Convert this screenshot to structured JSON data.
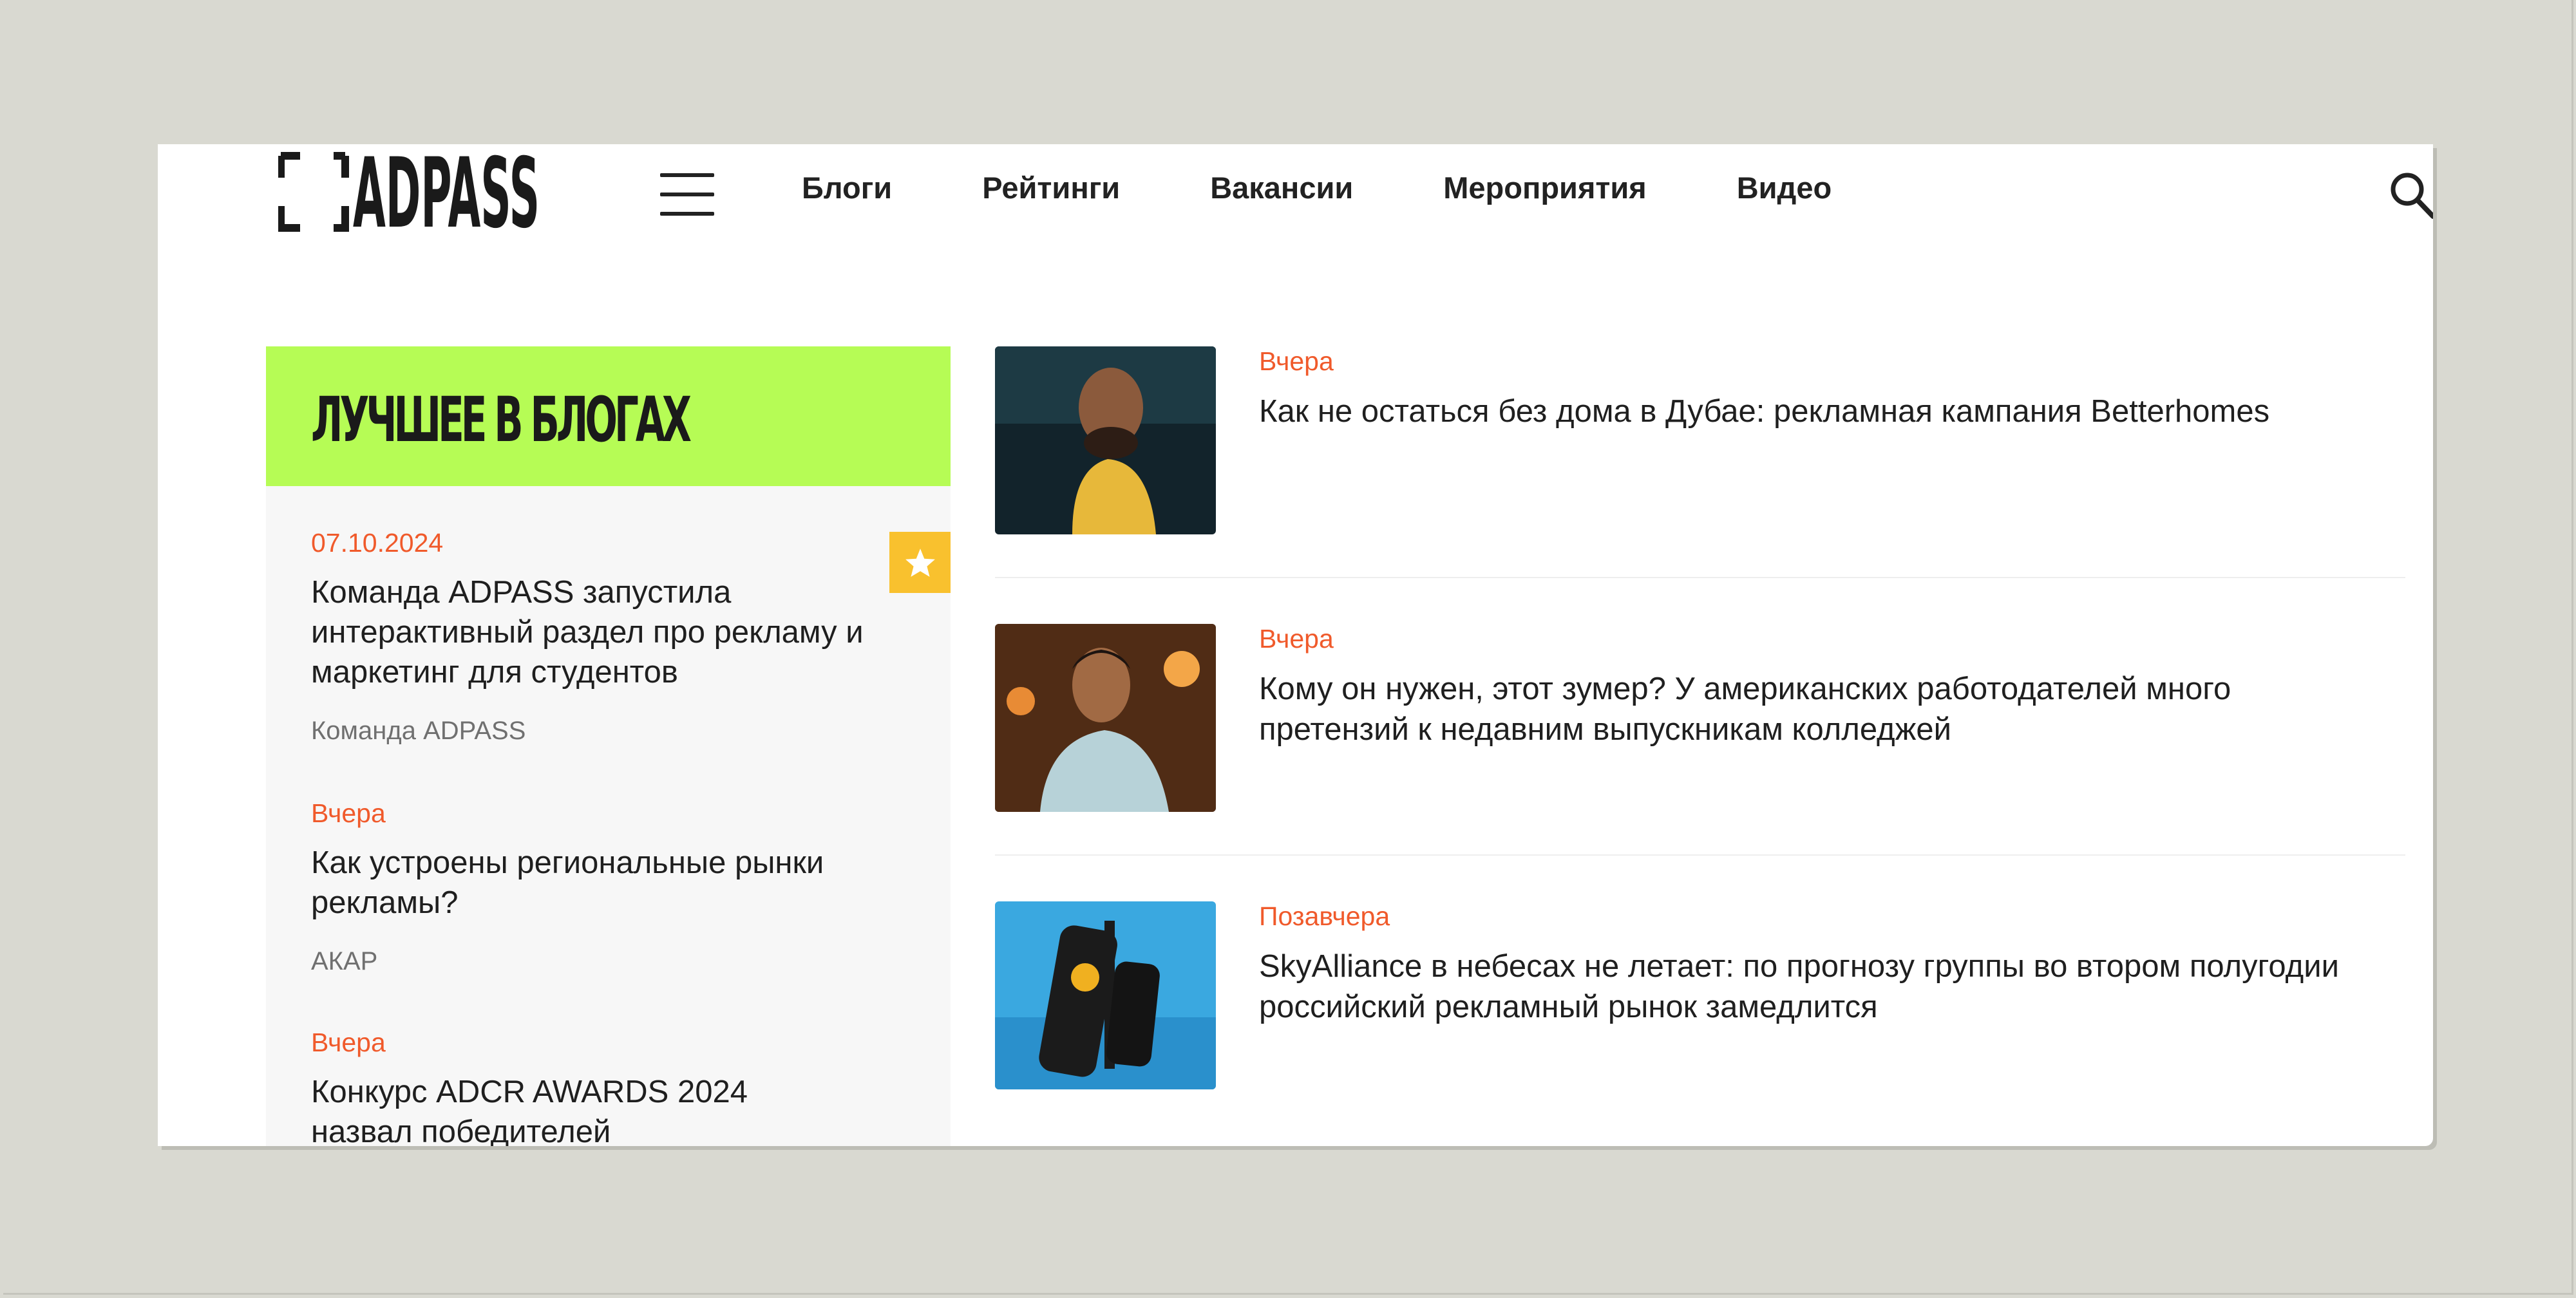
{
  "brand": {
    "logo_text": "ADPASS"
  },
  "nav": {
    "items": [
      "Блоги",
      "Рейтинги",
      "Вакансии",
      "Мероприятия",
      "Видео"
    ]
  },
  "icons": {
    "menu": "hamburger-menu-icon",
    "search": "search-icon",
    "badge": "star-icon"
  },
  "colors": {
    "accent_green": "#b6fc55",
    "date_orange": "#f05a2b",
    "badge_yellow": "#f9c12e"
  },
  "left_panel": {
    "title": "ЛУЧШЕЕ В БЛОГАХ",
    "items": [
      {
        "date": "07.10.2024",
        "title": "Команда ADPASS запустила интерактивный раздел про рекламу и маркетинг для студентов",
        "author": "Команда ADPASS"
      },
      {
        "date": "Вчера",
        "title": "Как устроены региональные рынки рекламы?",
        "author": "АКАР"
      },
      {
        "date": "Вчера",
        "title": "Конкурс ADCR AWARDS 2024 назвал победителей",
        "author": ""
      }
    ]
  },
  "news": [
    {
      "date": "Вчера",
      "title": "Как не остаться без дома в Дубае: рекламная кампания Betterhomes"
    },
    {
      "date": "Вчера",
      "title": "Кому он нужен, этот зумер? У американских работодателей много претензий к недавним выпускникам колледжей"
    },
    {
      "date": "Позавчера",
      "title": "SkyAlliance в небесах не летает: по прогнозу группы во втором полугодии российский рекламный рынок замедлится"
    }
  ]
}
